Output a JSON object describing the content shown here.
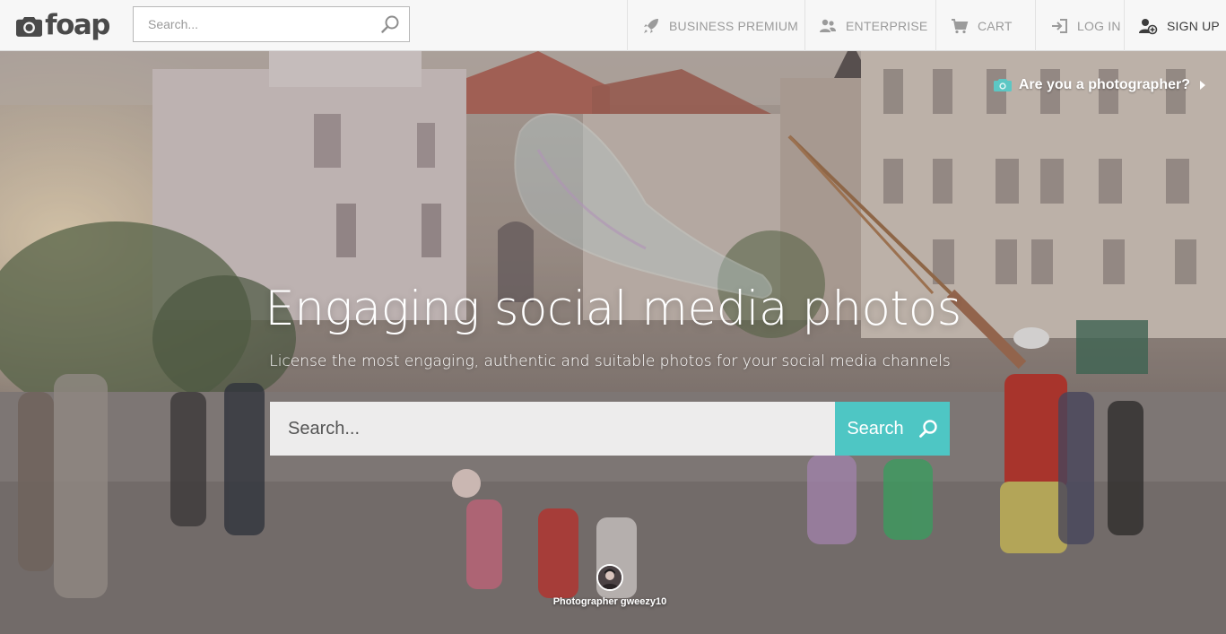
{
  "brand": {
    "name": "foap"
  },
  "header": {
    "search_placeholder": "Search...",
    "nav": [
      {
        "id": "business",
        "label": "BUSINESS PREMIUM",
        "icon": "rocket-icon"
      },
      {
        "id": "enterprise",
        "label": "ENTERPRISE",
        "icon": "group-icon"
      },
      {
        "id": "cart",
        "label": "CART",
        "icon": "cart-icon"
      },
      {
        "id": "login",
        "label": "LOG IN",
        "icon": "login-icon"
      },
      {
        "id": "signup",
        "label": "SIGN UP",
        "icon": "add-user-icon"
      }
    ]
  },
  "hero": {
    "photographer_cta": "Are you a photographer?",
    "headline": "Engaging social media photos",
    "subheadline": "License the most engaging, authentic and suitable photos for your social media channels",
    "search_placeholder": "Search...",
    "search_button": "Search",
    "credit": "Photographer gweezy10"
  },
  "colors": {
    "accent": "#4ec6c4",
    "nav_text": "#9b9b9b",
    "signup_text": "#3d3d3d",
    "camera_icon": "#5cc7c4"
  }
}
